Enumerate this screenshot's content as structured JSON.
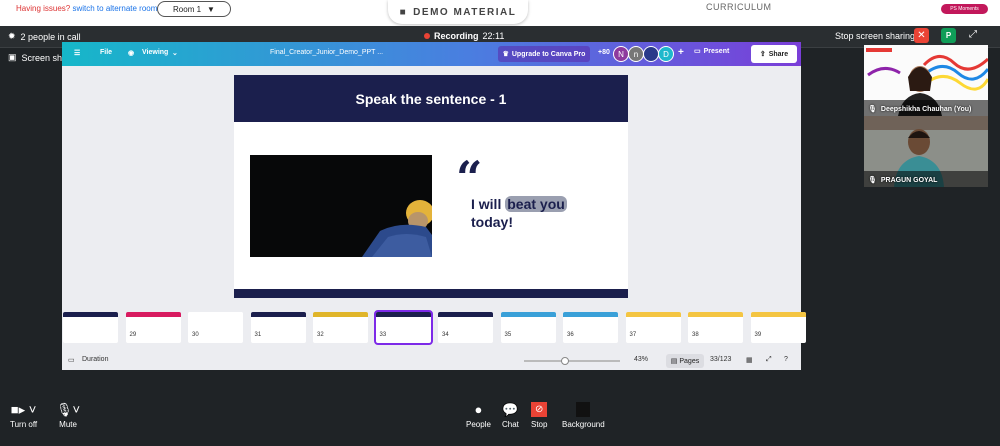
{
  "topbar": {
    "issues_text": "Having issues?",
    "alternate_room_link": "switch to alternate room",
    "room_selected": "Room 1",
    "demo_material": "DEMO MATERIAL",
    "curriculum": "CURRICULUM",
    "ps_moments": "PS Moments"
  },
  "call_header": {
    "people_count": "2 people in call",
    "recording_label": "Recording",
    "recording_time": "22:11",
    "stop_sharing": "Stop screen sharing",
    "presenter_initial": "P"
  },
  "share_label": "Screen share (You)",
  "canva": {
    "file_menu": "File",
    "viewing_menu": "Viewing",
    "doc_title": "Final_Creator_Junior_Demo_PPT ...",
    "upgrade_label": "Upgrade to Canva Pro",
    "collab_count": "+80",
    "collaborators": [
      "N",
      "n",
      "D"
    ],
    "present_label": "Present",
    "share_label": "Share",
    "colors": {
      "accent": "#7d2ae8",
      "slide_navy": "#1b1f4d"
    }
  },
  "slide": {
    "title": "Speak the sentence - 1",
    "quote_mark": "“",
    "sentence_part1": "I will",
    "sentence_highlight": "beat you",
    "sentence_part2": "today!"
  },
  "thumbnails": [
    {
      "num": "",
      "head_color": "#1b1f4d"
    },
    {
      "num": "29",
      "head_color": "#d81b60"
    },
    {
      "num": "30",
      "head_color": "#ffffff"
    },
    {
      "num": "31",
      "head_color": "#1b1f4d"
    },
    {
      "num": "32",
      "head_color": "#e0b52a"
    },
    {
      "num": "33",
      "head_color": "#1b1f4d",
      "active": true
    },
    {
      "num": "34",
      "head_color": "#1b1f4d"
    },
    {
      "num": "35",
      "head_color": "#3aa0d8"
    },
    {
      "num": "36",
      "head_color": "#3aa0d8"
    },
    {
      "num": "37",
      "head_color": "#f4c542"
    },
    {
      "num": "38",
      "head_color": "#f4c542"
    },
    {
      "num": "39",
      "head_color": "#f4c542"
    }
  ],
  "canva_footer": {
    "duration_label": "Duration",
    "zoom": "43%",
    "zoom_level": 0.43,
    "pages_label": "Pages",
    "page_counter": "33/123"
  },
  "participants": [
    {
      "name": "Deepshikha Chauhan (You)"
    },
    {
      "name": "PRAGUN GOYAL"
    }
  ],
  "controls": {
    "camera": "Turn off",
    "mic": "Mute",
    "people": "People",
    "chat": "Chat",
    "stop": "Stop",
    "background": "Background"
  }
}
